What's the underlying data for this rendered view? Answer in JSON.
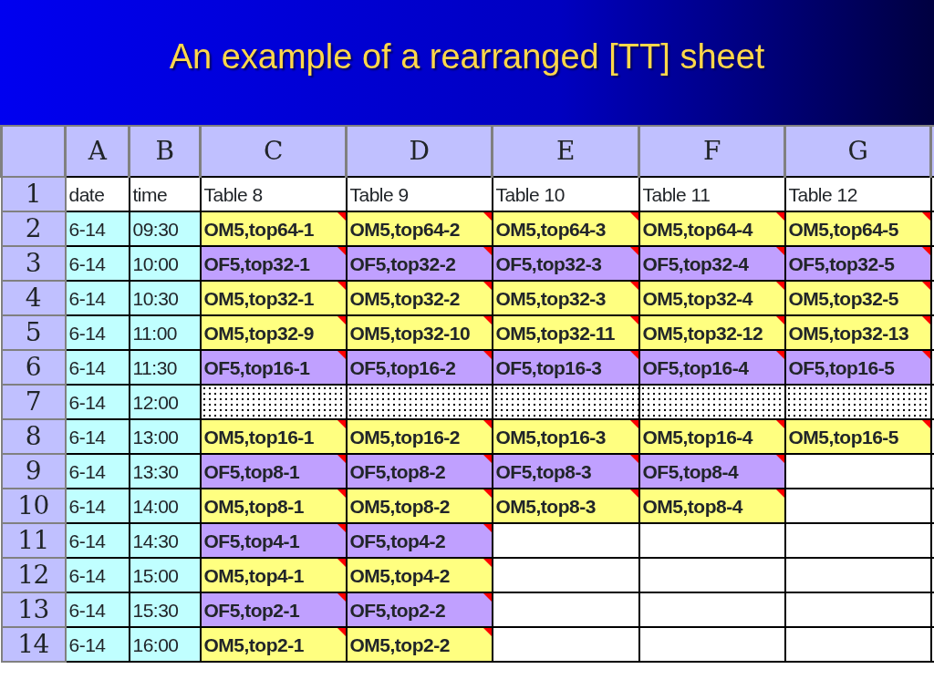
{
  "title": "An example of a rearranged [TT] sheet",
  "columns": [
    "A",
    "B",
    "C",
    "D",
    "E",
    "F",
    "G"
  ],
  "header_row": {
    "number": "1",
    "cells": [
      "date",
      "time",
      "Table 8",
      "Table 9",
      "Table 10",
      "Table 11",
      "Table 12"
    ]
  },
  "rows": [
    {
      "number": "2",
      "date": "6-14",
      "time": "09:30",
      "cells": [
        {
          "kind": "om",
          "text": "OM5,top64-1",
          "comment": true
        },
        {
          "kind": "om",
          "text": "OM5,top64-2",
          "comment": true
        },
        {
          "kind": "om",
          "text": "OM5,top64-3",
          "comment": true
        },
        {
          "kind": "om",
          "text": "OM5,top64-4",
          "comment": true
        },
        {
          "kind": "om",
          "text": "OM5,top64-5",
          "comment": true
        }
      ]
    },
    {
      "number": "3",
      "date": "6-14",
      "time": "10:00",
      "cells": [
        {
          "kind": "of",
          "text": "OF5,top32-1",
          "comment": true
        },
        {
          "kind": "of",
          "text": "OF5,top32-2",
          "comment": true
        },
        {
          "kind": "of",
          "text": "OF5,top32-3",
          "comment": true
        },
        {
          "kind": "of",
          "text": "OF5,top32-4",
          "comment": true
        },
        {
          "kind": "of",
          "text": "OF5,top32-5",
          "comment": true
        }
      ]
    },
    {
      "number": "4",
      "date": "6-14",
      "time": "10:30",
      "cells": [
        {
          "kind": "om",
          "text": "OM5,top32-1",
          "comment": true
        },
        {
          "kind": "om",
          "text": "OM5,top32-2",
          "comment": true
        },
        {
          "kind": "om",
          "text": "OM5,top32-3",
          "comment": true
        },
        {
          "kind": "om",
          "text": "OM5,top32-4",
          "comment": true
        },
        {
          "kind": "om",
          "text": "OM5,top32-5",
          "comment": true
        }
      ]
    },
    {
      "number": "5",
      "date": "6-14",
      "time": "11:00",
      "cells": [
        {
          "kind": "om",
          "text": "OM5,top32-9",
          "comment": true
        },
        {
          "kind": "om",
          "text": "OM5,top32-10",
          "comment": true
        },
        {
          "kind": "om",
          "text": "OM5,top32-11",
          "comment": true
        },
        {
          "kind": "om",
          "text": "OM5,top32-12",
          "comment": true
        },
        {
          "kind": "om",
          "text": "OM5,top32-13",
          "comment": true
        }
      ]
    },
    {
      "number": "6",
      "date": "6-14",
      "time": "11:30",
      "cells": [
        {
          "kind": "of",
          "text": "OF5,top16-1",
          "comment": true
        },
        {
          "kind": "of",
          "text": "OF5,top16-2",
          "comment": true
        },
        {
          "kind": "of",
          "text": "OF5,top16-3",
          "comment": true
        },
        {
          "kind": "of",
          "text": "OF5,top16-4",
          "comment": true
        },
        {
          "kind": "of",
          "text": "OF5,top16-5",
          "comment": true
        }
      ]
    },
    {
      "number": "7",
      "date": "6-14",
      "time": "12:00",
      "cells": [
        {
          "kind": "break"
        },
        {
          "kind": "break"
        },
        {
          "kind": "break"
        },
        {
          "kind": "break"
        },
        {
          "kind": "break"
        }
      ]
    },
    {
      "number": "8",
      "date": "6-14",
      "time": "13:00",
      "cells": [
        {
          "kind": "om",
          "text": "OM5,top16-1",
          "comment": true
        },
        {
          "kind": "om",
          "text": "OM5,top16-2",
          "comment": true
        },
        {
          "kind": "om",
          "text": "OM5,top16-3",
          "comment": true
        },
        {
          "kind": "om",
          "text": "OM5,top16-4",
          "comment": true
        },
        {
          "kind": "om",
          "text": "OM5,top16-5",
          "comment": true
        }
      ]
    },
    {
      "number": "9",
      "date": "6-14",
      "time": "13:30",
      "cells": [
        {
          "kind": "of",
          "text": "OF5,top8-1",
          "comment": true
        },
        {
          "kind": "of",
          "text": "OF5,top8-2",
          "comment": true
        },
        {
          "kind": "of",
          "text": "OF5,top8-3",
          "comment": true
        },
        {
          "kind": "of",
          "text": "OF5,top8-4",
          "comment": true
        },
        {
          "kind": "empty"
        }
      ]
    },
    {
      "number": "10",
      "date": "6-14",
      "time": "14:00",
      "cells": [
        {
          "kind": "om",
          "text": "OM5,top8-1",
          "comment": true
        },
        {
          "kind": "om",
          "text": "OM5,top8-2",
          "comment": true
        },
        {
          "kind": "om",
          "text": "OM5,top8-3",
          "comment": true
        },
        {
          "kind": "om",
          "text": "OM5,top8-4",
          "comment": true
        },
        {
          "kind": "empty"
        }
      ]
    },
    {
      "number": "11",
      "date": "6-14",
      "time": "14:30",
      "cells": [
        {
          "kind": "of",
          "text": "OF5,top4-1",
          "comment": true
        },
        {
          "kind": "of",
          "text": "OF5,top4-2",
          "comment": true
        },
        {
          "kind": "empty"
        },
        {
          "kind": "empty"
        },
        {
          "kind": "empty"
        }
      ]
    },
    {
      "number": "12",
      "date": "6-14",
      "time": "15:00",
      "cells": [
        {
          "kind": "om",
          "text": "OM5,top4-1",
          "comment": true
        },
        {
          "kind": "om",
          "text": "OM5,top4-2",
          "comment": true
        },
        {
          "kind": "empty"
        },
        {
          "kind": "empty"
        },
        {
          "kind": "empty"
        }
      ]
    },
    {
      "number": "13",
      "date": "6-14",
      "time": "15:30",
      "cells": [
        {
          "kind": "of",
          "text": "OF5,top2-1",
          "comment": true
        },
        {
          "kind": "of",
          "text": "OF5,top2-2",
          "comment": true
        },
        {
          "kind": "empty"
        },
        {
          "kind": "empty"
        },
        {
          "kind": "empty"
        }
      ]
    },
    {
      "number": "14",
      "date": "6-14",
      "time": "16:00",
      "cells": [
        {
          "kind": "om",
          "text": "OM5,top2-1",
          "comment": true
        },
        {
          "kind": "om",
          "text": "OM5,top2-2",
          "comment": true
        },
        {
          "kind": "empty"
        },
        {
          "kind": "empty"
        },
        {
          "kind": "empty"
        }
      ]
    }
  ]
}
